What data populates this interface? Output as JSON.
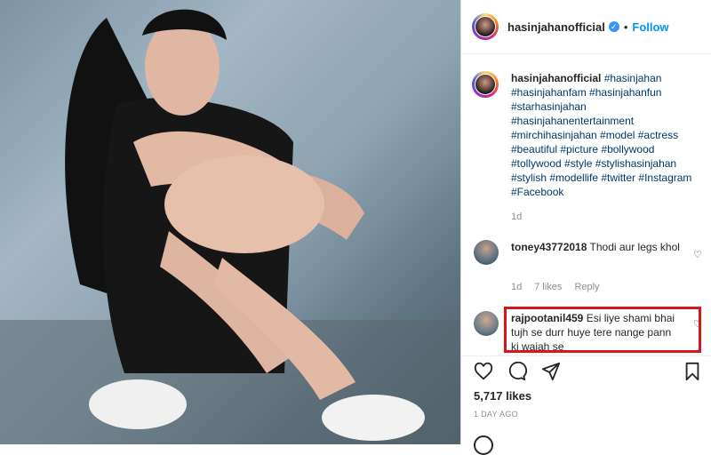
{
  "post": {
    "image_alt": "Photo of woman in black top sitting against wall",
    "username": "hasinjahanofficial",
    "verified_icon": "verified-badge-icon",
    "separator": "•",
    "follow_label": "Follow"
  },
  "caption": {
    "username": "hasinjahanofficial",
    "text": "#hasinjahan #hasinjahanfam #hasinjahanfun #starhasinjahan #hasinjahanentertainment #mirchihasinjahan #model #actress #beautiful #picture #bollywood #tollywood #style #stylishasinjahan #stylish #modellife #twitter #Instagram #Facebook",
    "time": "1d"
  },
  "comments": [
    {
      "username": "toney43772018",
      "text": "Thodi aur legs khol",
      "time": "1d",
      "likes": "7 likes",
      "reply_label": "Reply"
    },
    {
      "username": "rajpootanil459",
      "text": "Esi liye shami bhai tujh se durr huye tere nange pann ki wajah se"
    }
  ],
  "actions": {
    "like_icon": "heart-icon",
    "comment_icon": "comment-icon",
    "share_icon": "paper-plane-icon",
    "save_icon": "bookmark-icon"
  },
  "likes_count": "5,717 likes",
  "posted_ago": "1 DAY AGO",
  "colors": {
    "accent": "#0095f6",
    "highlight_box": "#d9151c"
  }
}
